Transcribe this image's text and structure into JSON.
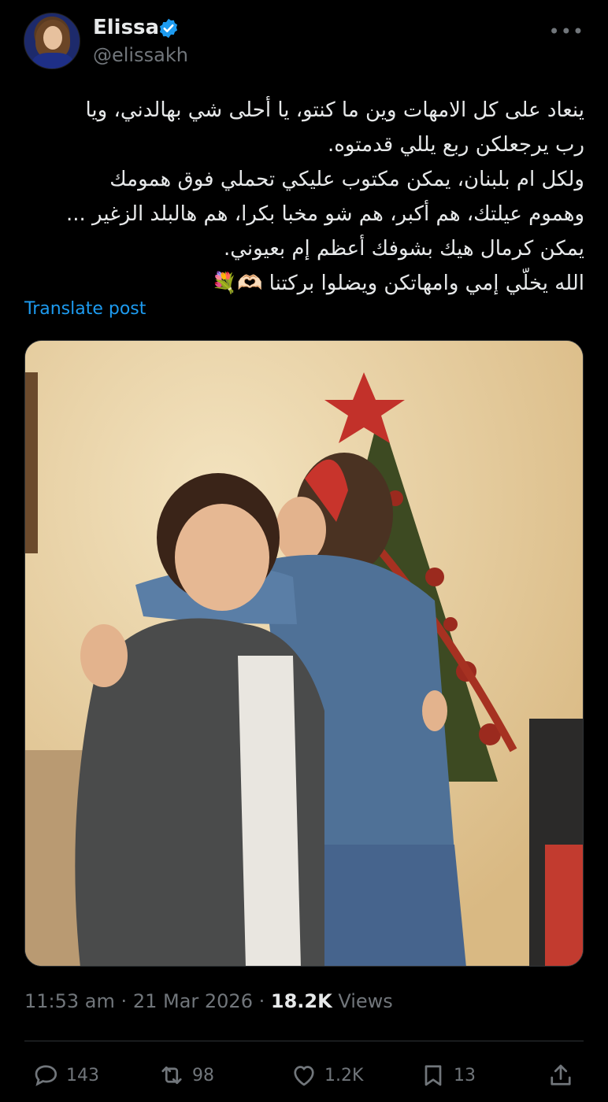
{
  "author": {
    "name": "Elissa",
    "handle": "@elissakh",
    "verified_color": "#1d9bf0"
  },
  "more_icon": "more-horizontal-icon",
  "tweet": {
    "lines": [
      "ينعاد على كل الامهات وين ما كنتو، يا أحلى شي بهالدني، ويا",
      "رب يرجعلكن ربع يللي قدمتوه.",
      "ولكل ام بلبنان، يمكن مكتوب عليكي تحملي فوق همومك",
      "وهموم عيلتك، هم أكبر، هم شو مخبا بكرا، هم هالبلد الزغير ...",
      "يمكن كرمال هيك بشوفك أعظم إم بعيوني.",
      "الله يخلّي إمي وامهاتكن ويضلوا بركتنا 🫶🏻💐"
    ]
  },
  "translate_label": "Translate post",
  "meta": {
    "time": "11:53 am",
    "separator": "·",
    "date": "21 Mar 2026",
    "views_count": "18.2K",
    "views_label": "Views"
  },
  "actions": {
    "replies": "143",
    "reposts": "98",
    "likes": "1.2K",
    "bookmarks": "13"
  },
  "colors": {
    "background": "#000000",
    "text": "#e7e9ea",
    "secondary": "#71767b",
    "link": "#1d9bf0"
  }
}
